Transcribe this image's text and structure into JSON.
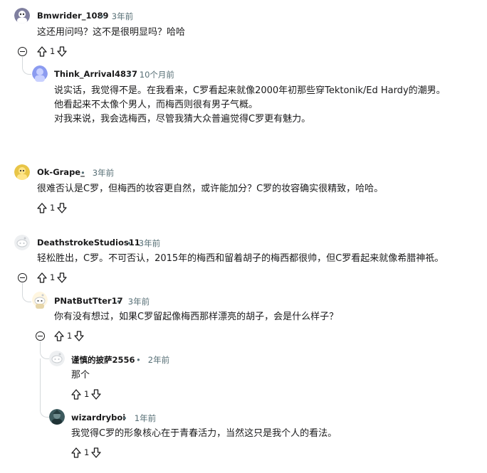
{
  "comments": [
    {
      "author": "Bmwrider_1089",
      "time": "3年前",
      "lines": [
        "这还用问吗？这不是很明显吗？哈哈"
      ],
      "votes": "1",
      "avatar_color": "#7f7f9f"
    },
    {
      "author": "Think_Arrival4837",
      "time": "10个月前",
      "lines": [
        "说实话，我觉得不是。在我看来，C罗看起来就像2000年初那些穿Tektonik/Ed Hardy的潮男。",
        "他看起来不太像个男人，而梅西则很有男子气概。",
        "对我来说，我会选梅西，尽管我猜大众普遍觉得C罗更有魅力。"
      ],
      "votes": "",
      "avatar_color": "#8b9bf0"
    },
    {
      "author": "Ok-Grape_",
      "time": "3年前",
      "lines": [
        "很难否认是C罗，但梅西的妆容更自然，或许能加分？C罗的妆容确实很精致，哈哈。"
      ],
      "votes": "1",
      "avatar_color": "#e8c547"
    },
    {
      "author": "DeathstrokeStudios11",
      "time": "3年前",
      "lines": [
        "轻松胜出，C罗。不可否认，2015年的梅西和留着胡子的梅西都很帅，但C罗看起来就像希腊神祇。"
      ],
      "votes": "1",
      "avatar_color": "#c8ccd0"
    },
    {
      "author": "PNatButTter17",
      "time": "3年前",
      "lines": [
        "你有没有想过，如果C罗留起像梅西那样漂亮的胡子，会是什么样子？"
      ],
      "votes": "1",
      "avatar_color": "#e6d5a8"
    },
    {
      "author": "谨慎的披萨2556",
      "time": "2年前",
      "lines": [
        "那个"
      ],
      "votes": "1",
      "avatar_color": "#c8ccd0"
    },
    {
      "author": "wizardryboi",
      "time": "1年前",
      "lines": [
        "我觉得C罗的形象核心在于青春活力，当然这只是我个人的看法。"
      ],
      "votes": "1",
      "avatar_color": "#3d5a5e"
    }
  ],
  "icons": {
    "upvote": "upvote-arrow-icon",
    "downvote": "downvote-arrow-icon",
    "collapse": "collapse-minus-icon"
  },
  "colors": {
    "text": "#1a1a1b",
    "meta": "#576f76",
    "thread_line": "#d4d8db"
  }
}
